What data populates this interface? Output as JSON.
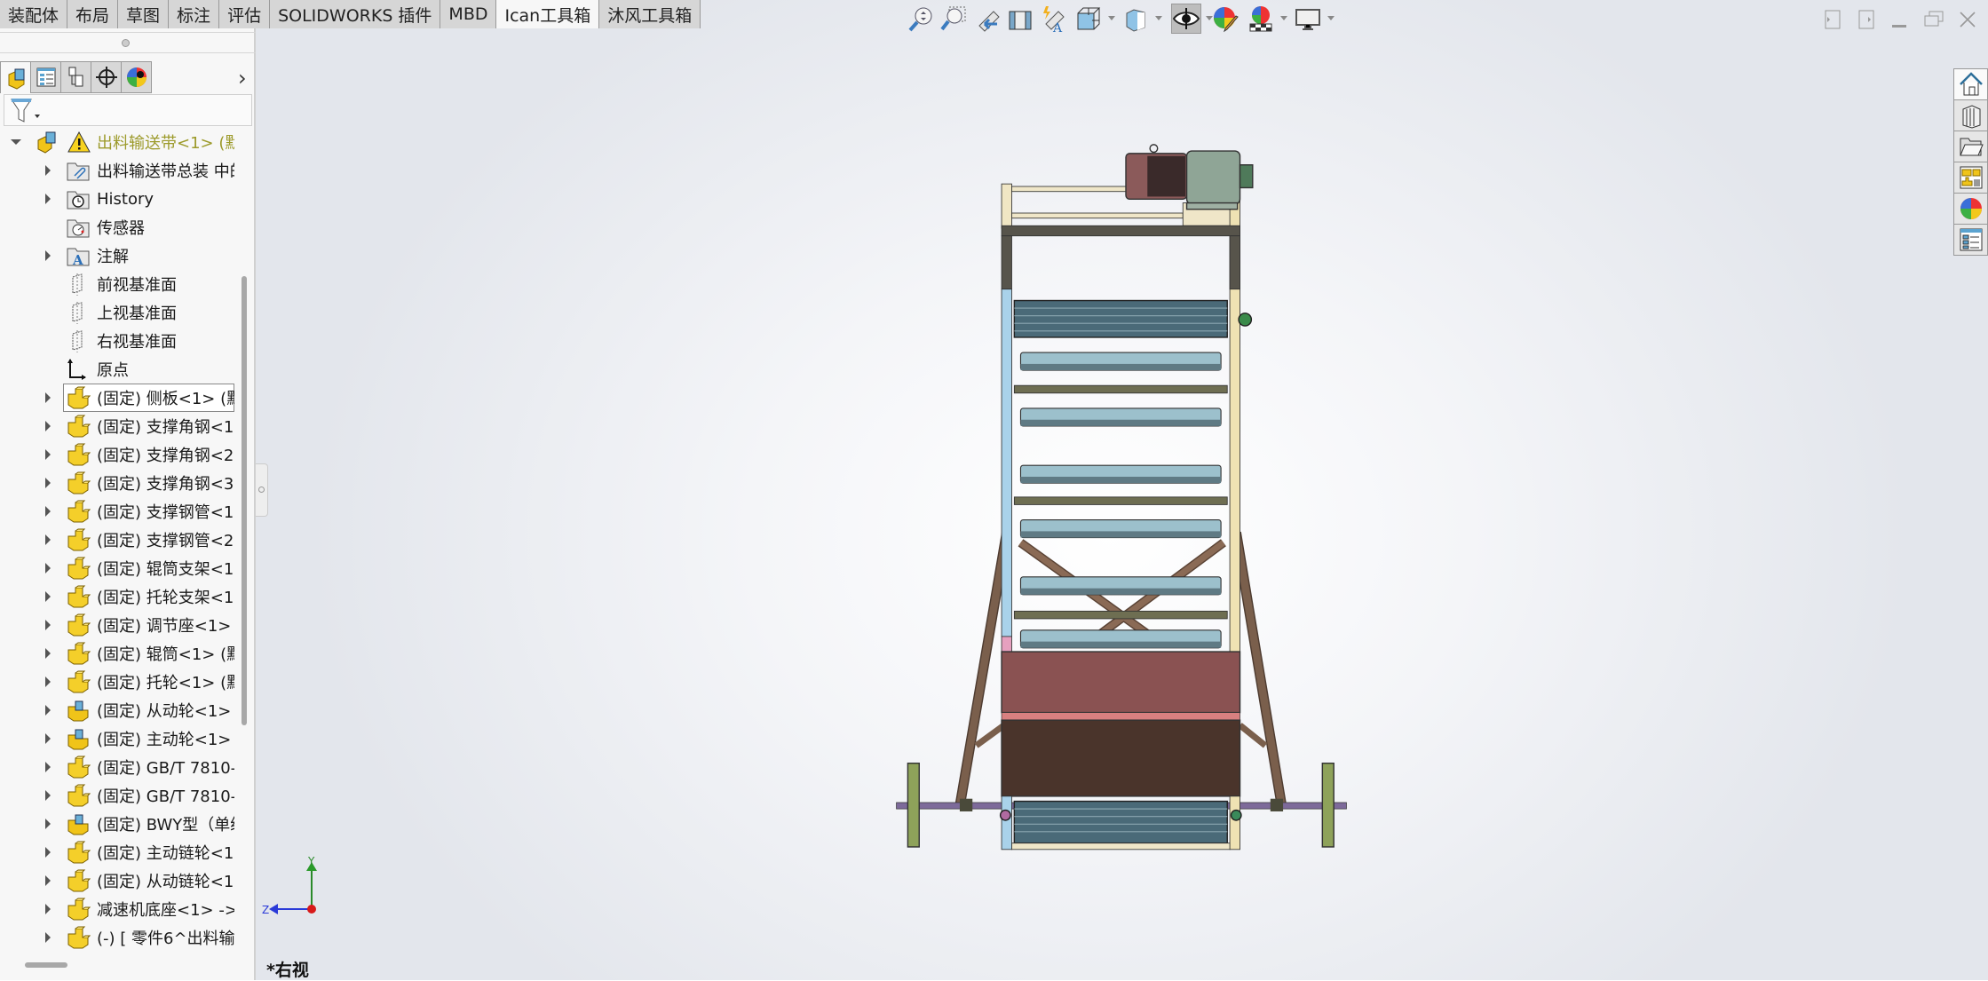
{
  "command_tabs": [
    {
      "label": "装配体",
      "active": false
    },
    {
      "label": "布局",
      "active": false
    },
    {
      "label": "草图",
      "active": false
    },
    {
      "label": "标注",
      "active": false
    },
    {
      "label": "评估",
      "active": false
    },
    {
      "label": "SOLIDWORKS 插件",
      "active": false
    },
    {
      "label": "MBD",
      "active": false
    },
    {
      "label": "Ican工具箱",
      "active": true
    },
    {
      "label": "沐风工具箱",
      "active": false
    }
  ],
  "panel": {
    "tabs": [
      "featuremanager-icon",
      "propertymanager-icon",
      "configurationmanager-icon",
      "dimxpertmanager-icon",
      "displaymanager-icon"
    ],
    "more_icon": "chevron-right-icon",
    "filter_icon": "filter-icon"
  },
  "tree": [
    {
      "label": "出料输送带<1> (默",
      "icon": "assembly",
      "arrow": "down",
      "level": 0,
      "warning": true,
      "color": "#9c9a2a"
    },
    {
      "label": "出料输送带总装 中的",
      "icon": "folder-attach",
      "arrow": "right",
      "level": 1
    },
    {
      "label": "History",
      "icon": "history",
      "arrow": "right",
      "level": 1
    },
    {
      "label": "传感器",
      "icon": "sensor",
      "arrow": "",
      "level": 1
    },
    {
      "label": "注解",
      "icon": "annotation",
      "arrow": "right",
      "level": 1
    },
    {
      "label": "前视基准面",
      "icon": "plane",
      "arrow": "",
      "level": 1
    },
    {
      "label": "上视基准面",
      "icon": "plane",
      "arrow": "",
      "level": 1
    },
    {
      "label": "右视基准面",
      "icon": "plane",
      "arrow": "",
      "level": 1
    },
    {
      "label": "原点",
      "icon": "origin",
      "arrow": "",
      "level": 1
    },
    {
      "label": "(固定) 侧板<1> (默",
      "icon": "part",
      "arrow": "right",
      "level": 1,
      "selected": true
    },
    {
      "label": "(固定) 支撑角钢<1>",
      "icon": "part",
      "arrow": "right",
      "level": 1
    },
    {
      "label": "(固定) 支撑角钢<2>",
      "icon": "part",
      "arrow": "right",
      "level": 1
    },
    {
      "label": "(固定) 支撑角钢<3>",
      "icon": "part",
      "arrow": "right",
      "level": 1
    },
    {
      "label": "(固定) 支撑钢管<1>",
      "icon": "part",
      "arrow": "right",
      "level": 1
    },
    {
      "label": "(固定) 支撑钢管<2>",
      "icon": "part",
      "arrow": "right",
      "level": 1
    },
    {
      "label": "(固定) 辊筒支架<1>",
      "icon": "part",
      "arrow": "right",
      "level": 1
    },
    {
      "label": "(固定) 托轮支架<1>",
      "icon": "part",
      "arrow": "right",
      "level": 1
    },
    {
      "label": "(固定) 调节座<1> (",
      "icon": "part",
      "arrow": "right",
      "level": 1
    },
    {
      "label": "(固定) 辊筒<1> (默",
      "icon": "part",
      "arrow": "right",
      "level": 1
    },
    {
      "label": "(固定) 托轮<1> (默",
      "icon": "part",
      "arrow": "right",
      "level": 1
    },
    {
      "label": "(固定) 从动轮<1> (",
      "icon": "subassembly",
      "arrow": "right",
      "level": 1
    },
    {
      "label": "(固定) 主动轮<1> (",
      "icon": "subassembly",
      "arrow": "right",
      "level": 1
    },
    {
      "label": "(固定) GB/T 7810-",
      "icon": "part",
      "arrow": "right",
      "level": 1
    },
    {
      "label": "(固定) GB/T 7810-",
      "icon": "part",
      "arrow": "right",
      "level": 1
    },
    {
      "label": "(固定) BWY型（单级",
      "icon": "subassembly",
      "arrow": "right",
      "level": 1
    },
    {
      "label": "(固定) 主动链轮<1>",
      "icon": "part",
      "arrow": "right",
      "level": 1
    },
    {
      "label": "(固定) 从动链轮<1>",
      "icon": "part",
      "arrow": "right",
      "level": 1
    },
    {
      "label": "减速机底座<1> ->",
      "icon": "part",
      "arrow": "right",
      "level": 1
    },
    {
      "label": "(-) [ 零件6^出料输送",
      "icon": "part",
      "arrow": "right",
      "level": 1
    }
  ],
  "view_toolbar": [
    "zoom-to-fit-icon",
    "zoom-to-area-icon",
    "previous-view-icon",
    "section-view-icon",
    "dynamic-annotation-views-icon",
    "view-orientation-icon",
    "display-style-icon",
    "hide-show-items-icon",
    "edit-appearance-icon",
    "apply-scene-icon",
    "view-settings-icon"
  ],
  "window_controls": [
    "tile-left-icon",
    "tile-right-icon",
    "minimize-icon",
    "restore-icon",
    "close-icon"
  ],
  "task_pane": [
    "solidworks-resources-icon",
    "design-library-icon",
    "file-explorer-icon",
    "view-palette-icon",
    "appearances-scenes-icon",
    "custom-properties-icon"
  ],
  "viewport": {
    "view_name": "*右视",
    "triad": {
      "y": "Y",
      "z": "Z"
    }
  }
}
